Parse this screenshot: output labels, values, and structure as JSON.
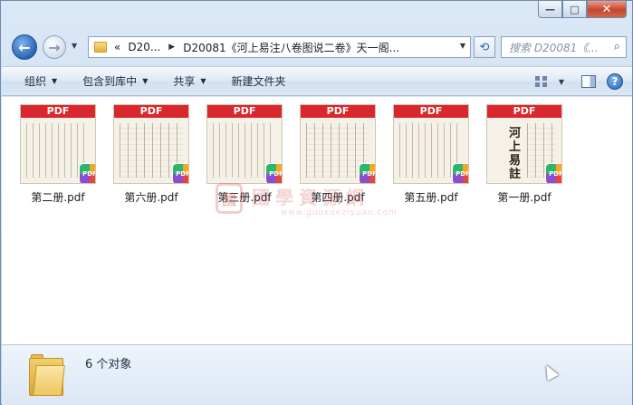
{
  "window": {
    "caption": {
      "minimize": "—",
      "maximize": "□",
      "close": "✕"
    }
  },
  "nav": {
    "back_glyph": "←",
    "forward_glyph": "→",
    "address": {
      "prefix": "«",
      "crumbs": [
        "D20...",
        "D20081《河上易注八卷图说二卷》天一阁..."
      ]
    },
    "refresh_glyph": "⟲",
    "search": {
      "placeholder": "搜索 D20081《...",
      "icon": "search-icon"
    }
  },
  "toolbar": {
    "items": [
      {
        "label": "组织",
        "has_dropdown": true
      },
      {
        "label": "包含到库中",
        "has_dropdown": true
      },
      {
        "label": "共享",
        "has_dropdown": true
      },
      {
        "label": "新建文件夹",
        "has_dropdown": false
      }
    ],
    "help_glyph": "?"
  },
  "files": [
    {
      "name": "第二册.pdf",
      "thumb_label": "PDF",
      "style": "lines"
    },
    {
      "name": "第六册.pdf",
      "thumb_label": "PDF",
      "style": "lines-alt"
    },
    {
      "name": "第三册.pdf",
      "thumb_label": "PDF",
      "style": "lines"
    },
    {
      "name": "第四册.pdf",
      "thumb_label": "PDF",
      "style": "lines-alt"
    },
    {
      "name": "第五册.pdf",
      "thumb_label": "PDF",
      "style": "lines"
    },
    {
      "name": "第一册.pdf",
      "thumb_label": "PDF",
      "style": "title",
      "cover_text": "河上易註"
    }
  ],
  "watermark": {
    "seal": "國",
    "text": "國學資源網",
    "url": "www.guoxueziyuan.com"
  },
  "status": {
    "count_text": "6 个对象"
  },
  "colors": {
    "pdf_banner": "#d9272d",
    "window_frame": "#c9dcef"
  }
}
